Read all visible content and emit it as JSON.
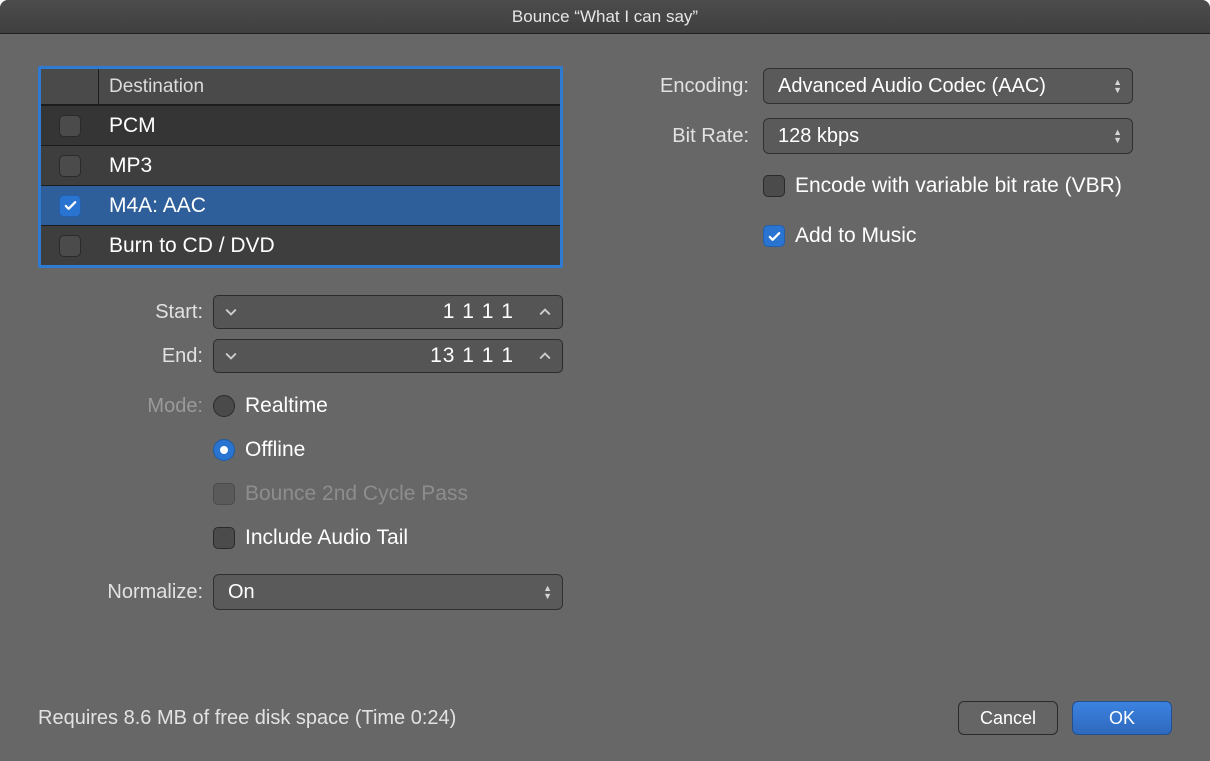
{
  "window": {
    "title": "Bounce “What I can say”"
  },
  "destination": {
    "header": "Destination",
    "rows": [
      {
        "label": "PCM",
        "checked": false,
        "selected": false
      },
      {
        "label": "MP3",
        "checked": false,
        "selected": false
      },
      {
        "label": "M4A: AAC",
        "checked": true,
        "selected": true
      },
      {
        "label": "Burn to CD / DVD",
        "checked": false,
        "selected": false
      }
    ]
  },
  "start": {
    "label": "Start:",
    "value": "1 1 1    1"
  },
  "end": {
    "label": "End:",
    "value": "13 1 1    1"
  },
  "mode": {
    "label": "Mode:",
    "realtime": "Realtime",
    "offline": "Offline",
    "secondpass": "Bounce 2nd Cycle Pass",
    "tail": "Include Audio Tail"
  },
  "normalize": {
    "label": "Normalize:",
    "value": "On"
  },
  "encoding": {
    "label": "Encoding:",
    "value": "Advanced Audio Codec (AAC)"
  },
  "bitrate": {
    "label": "Bit Rate:",
    "value": "128 kbps"
  },
  "vbr": "Encode with variable bit rate (VBR)",
  "music": "Add to Music",
  "status": "Requires 8.6 MB of free disk space  (Time 0:24)",
  "buttons": {
    "cancel": "Cancel",
    "ok": "OK"
  }
}
